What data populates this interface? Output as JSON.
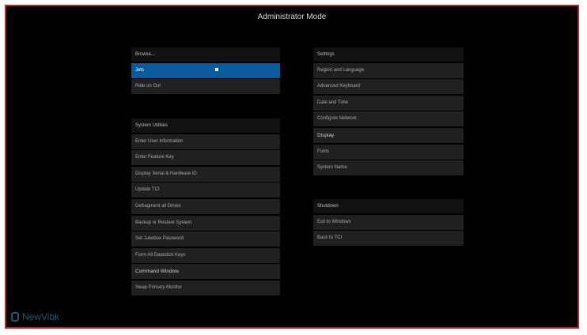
{
  "window": {
    "title": "Administrator Mode"
  },
  "browse": {
    "header": "Browse...",
    "items": [
      "Jets",
      "Ride on Out"
    ]
  },
  "utilities": {
    "header": "System Utilities",
    "items": [
      "Enter User Information",
      "Enter Feature Key",
      "Display Serial & Hardware ID",
      "Update TCI",
      "Defragment all Drives",
      "Backup or Restore System",
      "Set Jukebox Password",
      "Form All Datastick Keys",
      "Command Window",
      "Swap Primary Monitor"
    ]
  },
  "settings": {
    "header": "Settings",
    "items": [
      "Region and Language",
      "Advanced Keyboard",
      "Date and Time",
      "Configure Network",
      "Display",
      "Fonts",
      "System Name"
    ]
  },
  "shutdown": {
    "header": "Shutdown",
    "items": [
      "Exit to Windows",
      "Back to TCI"
    ]
  },
  "branding": {
    "logo_text": "NewVibk"
  },
  "colors": {
    "selected": "#0a5a9e",
    "frame_border": "#b3262b",
    "item_bg": "#202020"
  }
}
